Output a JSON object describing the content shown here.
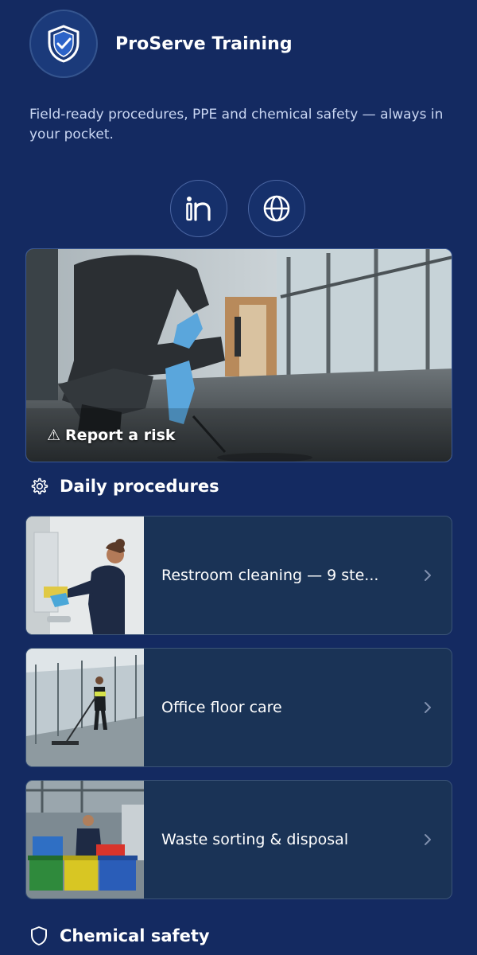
{
  "app": {
    "title": "ProServe Training",
    "tagline": "Field-ready procedures, PPE and chemical safety — always in your pocket."
  },
  "social": [
    {
      "icon": "linkedin-icon"
    },
    {
      "icon": "globe-icon"
    }
  ],
  "hero": {
    "label": "Report a risk",
    "icon": "warning-icon",
    "glyph": "⚠"
  },
  "sections": {
    "daily": {
      "title": "Daily procedures",
      "icon": "gear-icon"
    },
    "chemical": {
      "title": "Chemical safety",
      "icon": "shield-icon"
    }
  },
  "procedures": [
    {
      "label": "Restroom cleaning — 9 ste...",
      "icon": "chevron-right-icon"
    },
    {
      "label": "Office floor care",
      "icon": "chevron-right-icon"
    },
    {
      "label": "Waste sorting & disposal",
      "icon": "chevron-right-icon"
    }
  ],
  "colors": {
    "background": "#142a61",
    "card": "#1a3356",
    "accent": "#4a9fe0"
  }
}
